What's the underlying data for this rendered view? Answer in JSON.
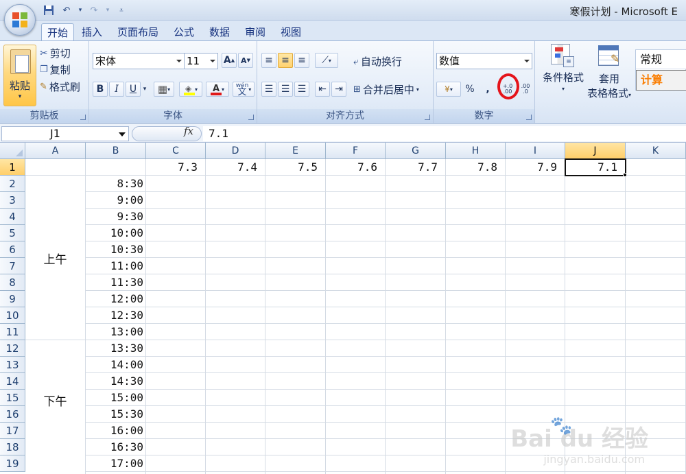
{
  "window": {
    "title": "寒假计划 - Microsoft E"
  },
  "tabs": [
    {
      "label": "开始",
      "active": true
    },
    {
      "label": "插入"
    },
    {
      "label": "页面布局"
    },
    {
      "label": "公式"
    },
    {
      "label": "数据"
    },
    {
      "label": "审阅"
    },
    {
      "label": "视图"
    }
  ],
  "clipboard": {
    "paste": "粘贴",
    "cut": "剪切",
    "copy": "复制",
    "format_painter": "格式刷",
    "group_label": "剪贴板"
  },
  "font": {
    "name": "宋体",
    "size": "11",
    "group_label": "字体",
    "bold": "B",
    "italic": "I",
    "underline": "U",
    "grow": "A",
    "shrink": "A",
    "font_color_letter": "A",
    "phonetic": "wén"
  },
  "alignment": {
    "wrap_text": "自动换行",
    "merge_center": "合并后居中",
    "group_label": "对齐方式"
  },
  "number": {
    "format": "数值",
    "percent": "%",
    "comma": ",",
    "increase_decimal": "+.0 .00",
    "decrease_decimal": ".00 .0",
    "group_label": "数字"
  },
  "styles": {
    "conditional_formatting": "条件格式",
    "format_as_table_line1": "套用",
    "format_as_table_line2": "表格格式",
    "style_normal": "常规",
    "style_calc": "计算"
  },
  "formula_bar": {
    "name_box": "J1",
    "fx": "fx",
    "value": "7.1"
  },
  "columns": [
    "A",
    "B",
    "C",
    "D",
    "E",
    "F",
    "G",
    "H",
    "I",
    "J",
    "K"
  ],
  "rows": [
    "1",
    "2",
    "3",
    "4",
    "5",
    "6",
    "7",
    "8",
    "9",
    "10",
    "11",
    "12",
    "13",
    "14",
    "15",
    "16",
    "17",
    "18",
    "19"
  ],
  "header_row": [
    "7.3",
    "7.4",
    "7.5",
    "7.6",
    "7.7",
    "7.8",
    "7.9",
    "7.1"
  ],
  "times": [
    "8:30",
    "9:00",
    "9:30",
    "10:00",
    "10:30",
    "11:00",
    "11:30",
    "12:00",
    "12:30",
    "13:00",
    "13:30",
    "14:00",
    "14:30",
    "15:00",
    "15:30",
    "16:00",
    "16:30",
    "17:00"
  ],
  "periods": {
    "am": "上午",
    "pm": "下午"
  },
  "watermark": {
    "main": "Bai du 经验",
    "sub": "jingyan.baidu.com"
  },
  "colors": {
    "highlight_circle": "#e5141b",
    "selected_header": "#ffcf6a"
  }
}
